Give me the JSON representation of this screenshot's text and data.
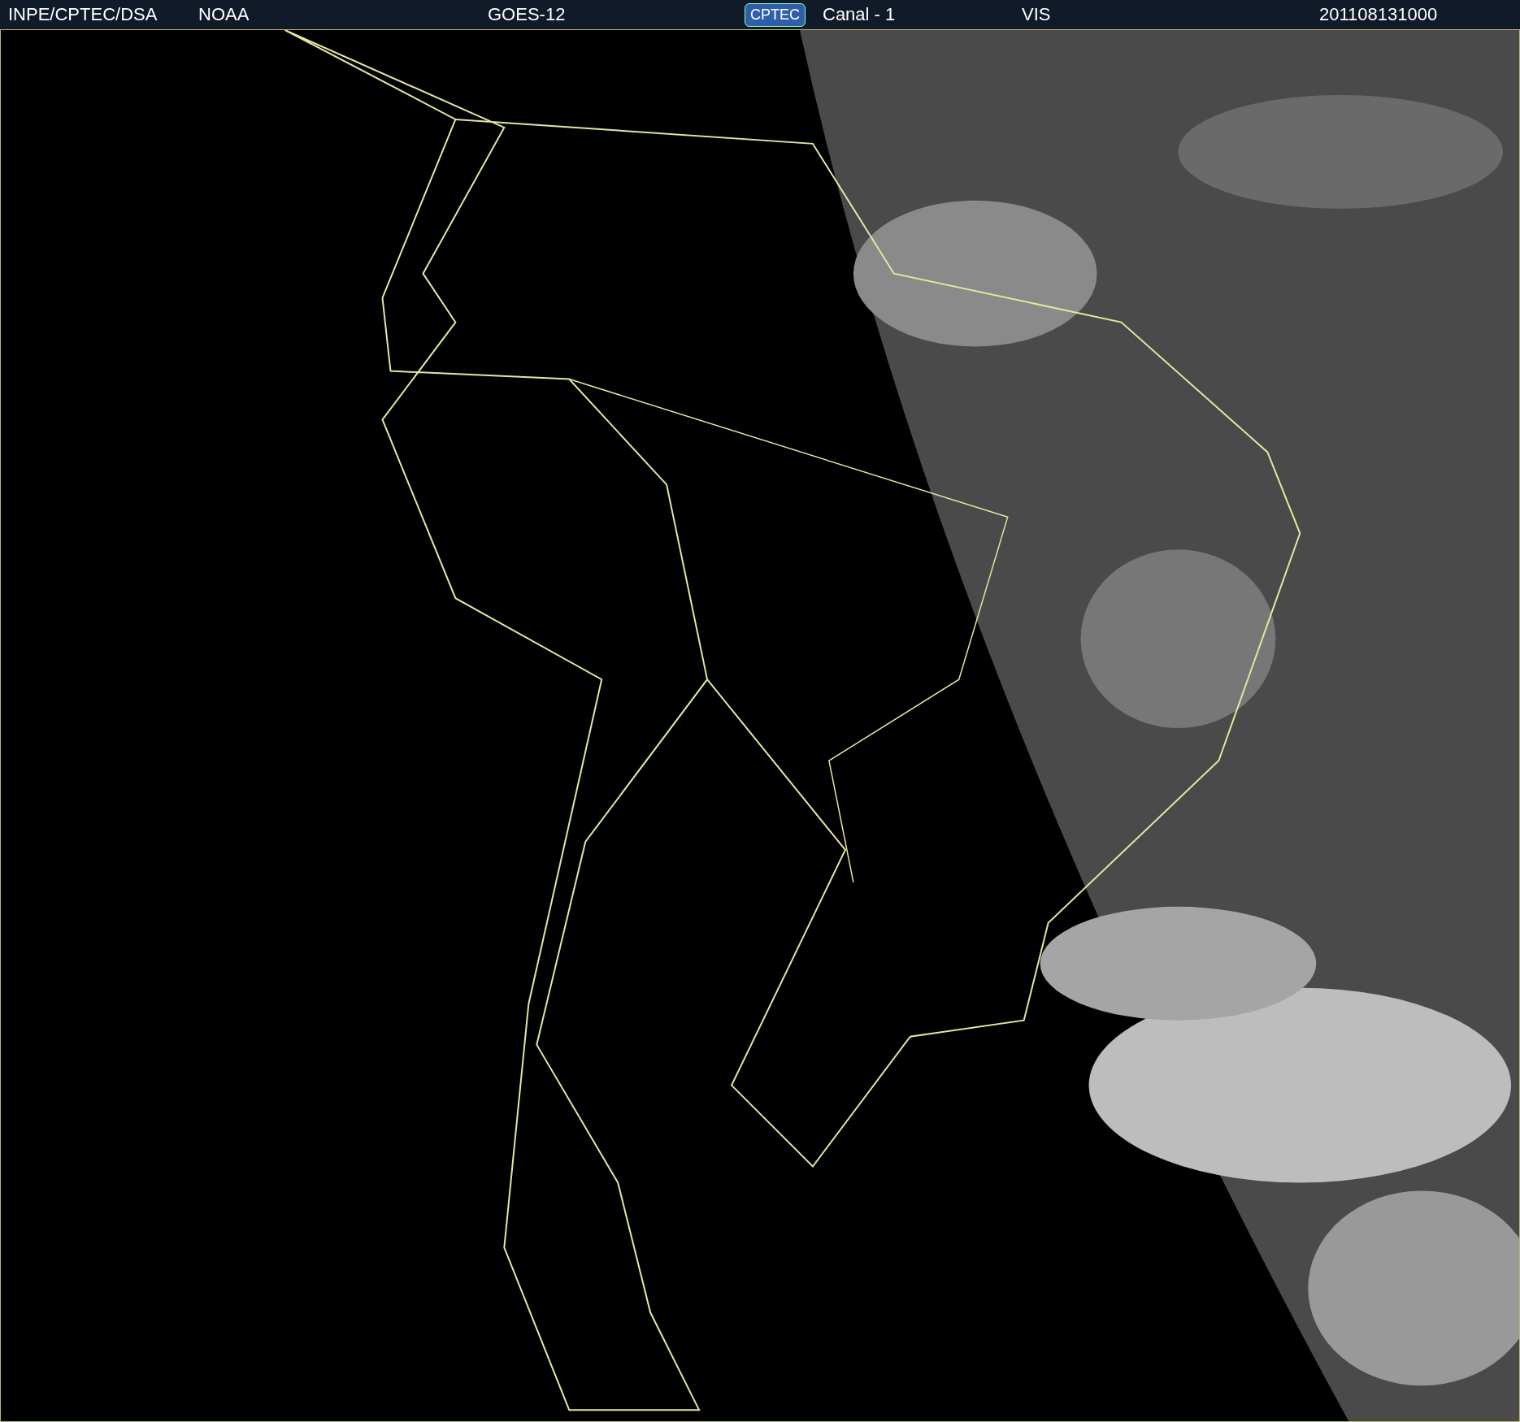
{
  "header": {
    "items": [
      {
        "kind": "text",
        "text": "INPE/CPTEC/DSA"
      },
      {
        "kind": "text",
        "text": "NOAA"
      },
      {
        "kind": "text",
        "text": "GOES-12"
      },
      {
        "kind": "logo",
        "text": "CPTEC"
      },
      {
        "kind": "text",
        "text": "Canal - 1"
      },
      {
        "kind": "text",
        "text": "VIS"
      },
      {
        "kind": "text",
        "text": "201108131000"
      }
    ]
  }
}
